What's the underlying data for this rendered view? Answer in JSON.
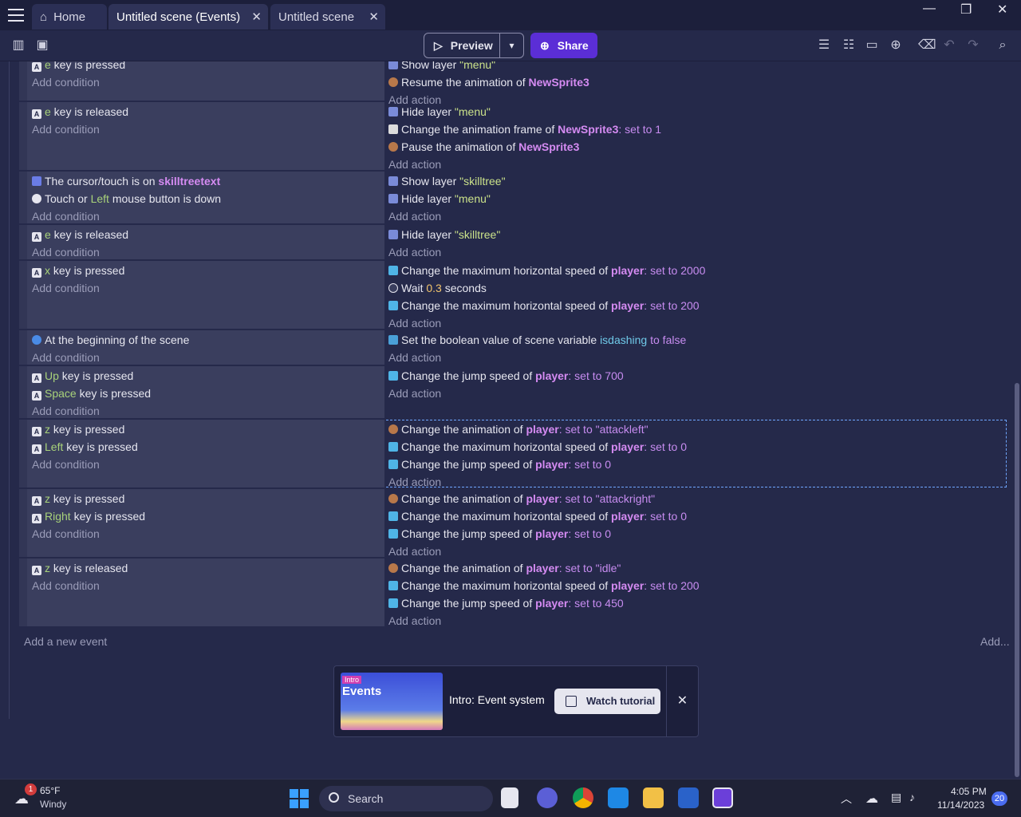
{
  "tabs": [
    {
      "label": "Home"
    },
    {
      "label": "Untitled scene (Events)"
    },
    {
      "label": "Untitled scene"
    }
  ],
  "toolbar": {
    "preview_label": "Preview",
    "share_label": "Share"
  },
  "events": [
    {
      "conds": [
        [
          "key",
          "",
          "e",
          " key is pressed"
        ]
      ],
      "acts": [
        [
          "layer",
          "Show layer ",
          "\"menu\"",
          ""
        ],
        [
          "anim",
          "Resume the animation of ",
          "NewSprite3",
          ""
        ]
      ]
    },
    {
      "conds": [
        [
          "key",
          "",
          "e",
          " key is released"
        ]
      ],
      "acts": [
        [
          "layer",
          "Hide layer ",
          "\"menu\"",
          ""
        ],
        [
          "frame",
          "Change the animation frame of ",
          "NewSprite3",
          ": set to 1"
        ],
        [
          "anim",
          "Pause the animation of ",
          "NewSprite3",
          ""
        ]
      ]
    },
    {
      "conds": [
        [
          "cursor",
          "The cursor/touch is on ",
          "skilltreetext",
          ""
        ],
        [
          "mouse",
          "Touch or ",
          "Left",
          " mouse button is down"
        ]
      ],
      "acts": [
        [
          "layer",
          "Show layer ",
          "\"skilltree\"",
          ""
        ],
        [
          "layer",
          "Hide layer ",
          "\"menu\"",
          ""
        ]
      ]
    },
    {
      "conds": [
        [
          "key",
          "",
          "e",
          " key is released"
        ]
      ],
      "acts": [
        [
          "layer",
          "Hide layer ",
          "\"skilltree\"",
          ""
        ]
      ]
    },
    {
      "conds": [
        [
          "key",
          "",
          "x",
          " key is pressed"
        ]
      ],
      "acts": [
        [
          "speed",
          "Change the maximum horizontal speed of ",
          "player",
          ": set to 2000"
        ],
        [
          "wait",
          "Wait ",
          "0.3",
          " seconds"
        ],
        [
          "speed",
          "Change the maximum horizontal speed of ",
          "player",
          ": set to 200"
        ]
      ]
    },
    {
      "conds": [
        [
          "scene",
          "At the beginning of the scene",
          "",
          ""
        ]
      ],
      "acts": [
        [
          "var",
          "Set the boolean value of scene variable ",
          "isdashing",
          " to false"
        ]
      ]
    },
    {
      "conds": [
        [
          "key",
          "",
          "Up",
          " key is pressed"
        ],
        [
          "key",
          "",
          "Space",
          " key is pressed"
        ]
      ],
      "acts": [
        [
          "speed",
          "Change the jump speed of ",
          "player",
          ": set to 700"
        ]
      ]
    },
    {
      "conds": [
        [
          "key",
          "",
          "z",
          " key is pressed"
        ],
        [
          "key",
          "",
          "Left",
          " key is pressed"
        ]
      ],
      "acts": [
        [
          "anim",
          "Change the animation of ",
          "player",
          ": set to \"attackleft\""
        ],
        [
          "speed",
          "Change the maximum horizontal speed of ",
          "player",
          ": set to 0"
        ],
        [
          "speed",
          "Change the jump speed of ",
          "player",
          ": set to 0"
        ]
      ]
    },
    {
      "conds": [
        [
          "key",
          "",
          "z",
          " key is pressed"
        ],
        [
          "key",
          "",
          "Right",
          " key is pressed"
        ]
      ],
      "acts": [
        [
          "anim",
          "Change the animation of ",
          "player",
          ": set to \"attackright\""
        ],
        [
          "speed",
          "Change the maximum horizontal speed of ",
          "player",
          ": set to 0"
        ],
        [
          "speed",
          "Change the jump speed of ",
          "player",
          ": set to 0"
        ]
      ]
    },
    {
      "conds": [
        [
          "key",
          "",
          "z",
          " key is released"
        ]
      ],
      "acts": [
        [
          "anim",
          "Change the animation of ",
          "player",
          ": set to \"idle\""
        ],
        [
          "speed",
          "Change the maximum horizontal speed of ",
          "player",
          ": set to 200"
        ],
        [
          "speed",
          "Change the jump speed of ",
          "player",
          ": set to 450"
        ]
      ]
    }
  ],
  "labels": {
    "add_condition": "Add condition",
    "add_action": "Add action",
    "add_new_event": "Add a new event",
    "add_more": "Add..."
  },
  "tutorial": {
    "badge": "Intro",
    "thumb_title": "Events",
    "title": "Intro: Event system",
    "button": "Watch tutorial",
    "close": "✕"
  },
  "taskbar": {
    "notification_count": "1",
    "temperature": "65°F",
    "condition": "Windy",
    "search_placeholder": "Search",
    "time": "4:05 PM",
    "date": "11/14/2023",
    "tray_count": "20"
  }
}
